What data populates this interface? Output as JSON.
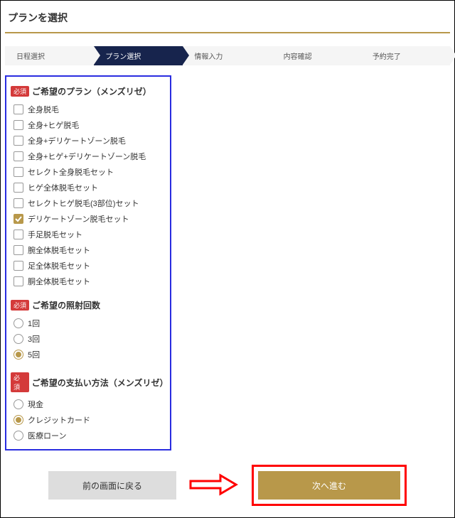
{
  "page_title": "プランを選択",
  "steps": [
    {
      "label": "日程選択",
      "active": false
    },
    {
      "label": "プラン選択",
      "active": true
    },
    {
      "label": "情報入力",
      "active": false
    },
    {
      "label": "内容確認",
      "active": false
    },
    {
      "label": "予約完了",
      "active": false
    }
  ],
  "required_badge": "必須",
  "sections": {
    "plan": {
      "title": "ご希望のプラン（メンズリゼ）",
      "options": [
        {
          "label": "全身脱毛",
          "checked": false
        },
        {
          "label": "全身+ヒゲ脱毛",
          "checked": false
        },
        {
          "label": "全身+デリケートゾーン脱毛",
          "checked": false
        },
        {
          "label": "全身+ヒゲ+デリケートゾーン脱毛",
          "checked": false
        },
        {
          "label": "セレクト全身脱毛セット",
          "checked": false
        },
        {
          "label": "ヒゲ全体脱毛セット",
          "checked": false
        },
        {
          "label": "セレクトヒゲ脱毛(3部位)セット",
          "checked": false
        },
        {
          "label": "デリケートゾーン脱毛セット",
          "checked": true
        },
        {
          "label": "手足脱毛セット",
          "checked": false
        },
        {
          "label": "腕全体脱毛セット",
          "checked": false
        },
        {
          "label": "足全体脱毛セット",
          "checked": false
        },
        {
          "label": "胴全体脱毛セット",
          "checked": false
        }
      ]
    },
    "count": {
      "title": "ご希望の照射回数",
      "options": [
        {
          "label": "1回",
          "checked": false
        },
        {
          "label": "3回",
          "checked": false
        },
        {
          "label": "5回",
          "checked": true
        }
      ]
    },
    "payment": {
      "title": "ご希望の支払い方法（メンズリゼ）",
      "options": [
        {
          "label": "現金",
          "checked": false
        },
        {
          "label": "クレジットカード",
          "checked": true
        },
        {
          "label": "医療ローン",
          "checked": false
        }
      ]
    }
  },
  "buttons": {
    "back": "前の画面に戻る",
    "next": "次へ進む"
  }
}
